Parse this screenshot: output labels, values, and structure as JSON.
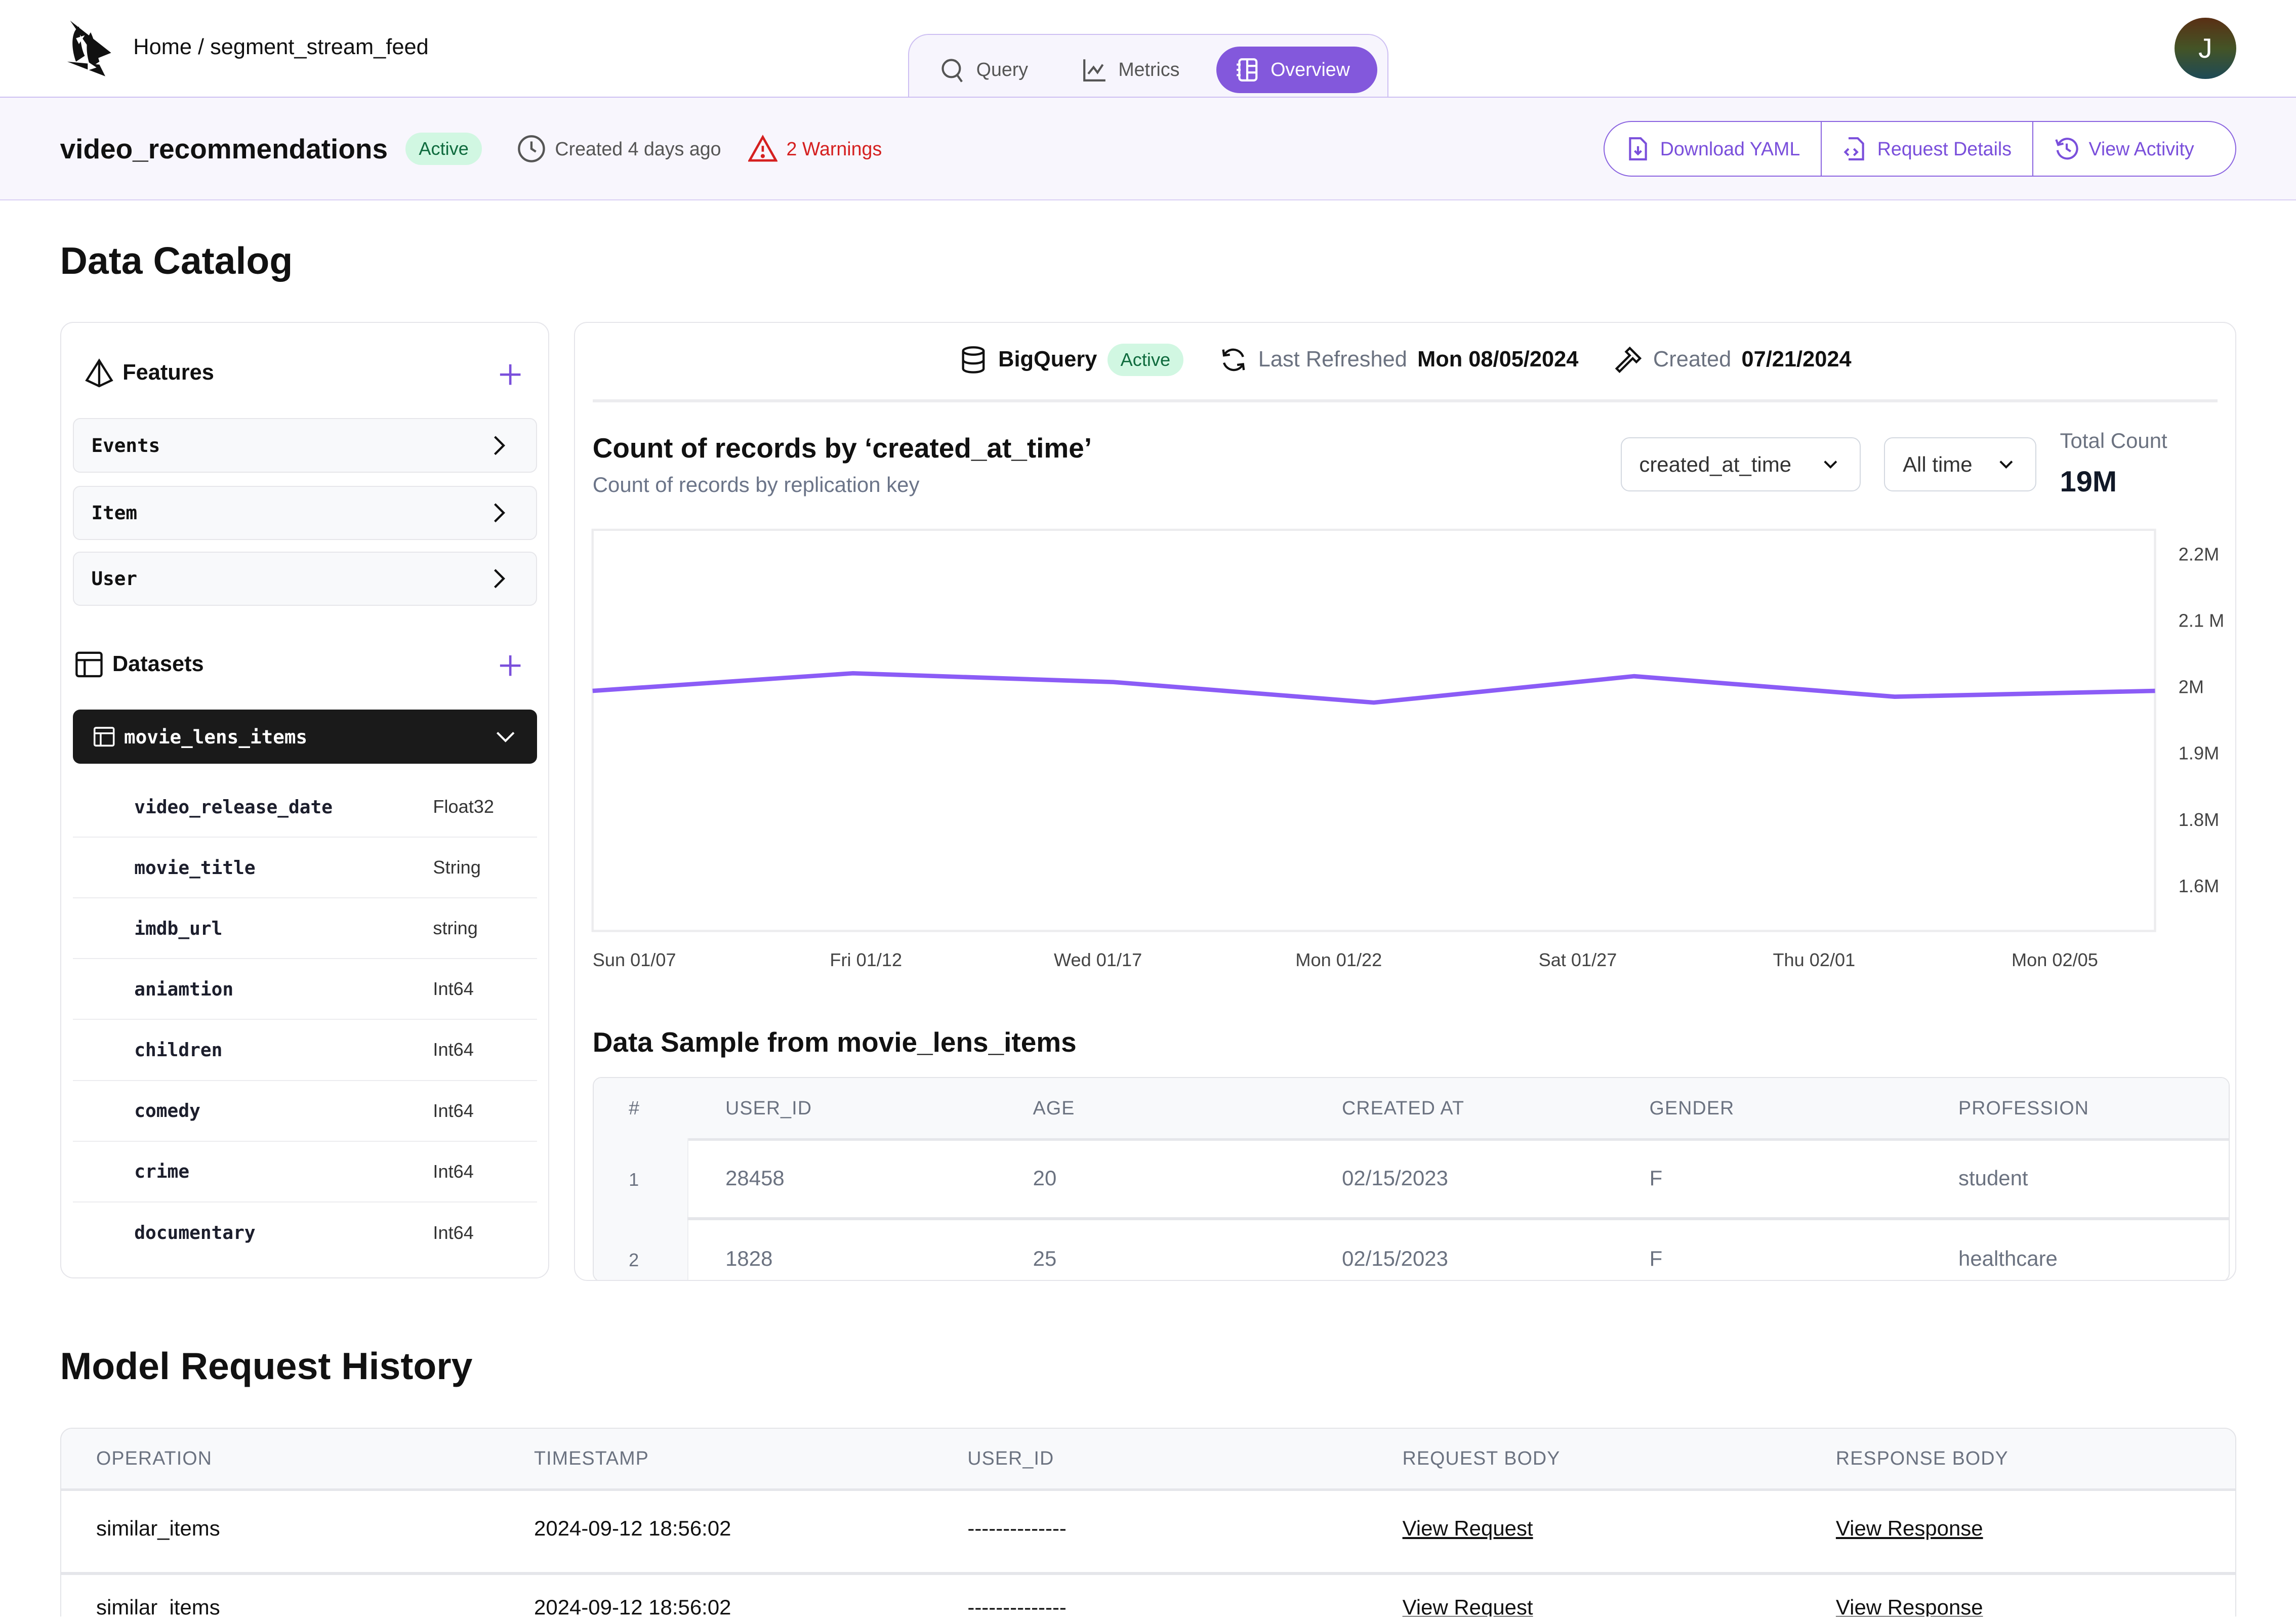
{
  "topbar": {
    "breadcrumb": "Home / segment_stream_feed",
    "tabs": [
      {
        "label": "Query",
        "icon": "search-icon",
        "active": false
      },
      {
        "label": "Metrics",
        "icon": "line-chart-icon",
        "active": false
      },
      {
        "label": "Overview",
        "icon": "notebook-icon",
        "active": true
      }
    ],
    "avatar_initial": "J"
  },
  "model": {
    "name": "video_recommendations",
    "status": "Active",
    "created": "Created 4 days ago",
    "warnings": "2 Warnings",
    "actions": [
      "Download YAML",
      "Request Details",
      "View Activity"
    ]
  },
  "catalog": {
    "title": "Data Catalog",
    "features_label": "Features",
    "features": [
      "Events",
      "Item",
      "User"
    ],
    "datasets_label": "Datasets",
    "selected_dataset": "movie_lens_items",
    "columns": [
      {
        "name": "video_release_date",
        "type": "Float32"
      },
      {
        "name": "movie_title",
        "type": "String"
      },
      {
        "name": "imdb_url",
        "type": "string"
      },
      {
        "name": "aniamtion",
        "type": "Int64"
      },
      {
        "name": "children",
        "type": "Int64"
      },
      {
        "name": "comedy",
        "type": "Int64"
      },
      {
        "name": "crime",
        "type": "Int64"
      },
      {
        "name": "documentary",
        "type": "Int64"
      }
    ]
  },
  "source": {
    "name": "BigQuery",
    "status": "Active",
    "last_refreshed_label": "Last Refreshed",
    "last_refreshed": "Mon 08/05/2024",
    "created_label": "Created",
    "created": "07/21/2024"
  },
  "chart_panel": {
    "title": "Count of records by ‘created_at_time’",
    "subtitle": "Count of records by replication key",
    "key_select": "created_at_time",
    "range_select": "All time",
    "total_label": "Total Count",
    "total_value": "19M"
  },
  "chart_data": {
    "type": "line",
    "title": "Count of records by ‘created_at_time’",
    "xlabel": "",
    "ylabel": "",
    "x": [
      "Sun 01/07",
      "Fri 01/12",
      "Wed 01/17",
      "Mon 01/22",
      "Sat 01/27",
      "Thu 02/01",
      "Mon 02/05"
    ],
    "series": [
      {
        "name": "Count of records",
        "color": "#8b5cf6",
        "values": [
          1960000,
          1990000,
          1975000,
          1940000,
          1985000,
          1950000,
          1960000
        ]
      }
    ],
    "y_ticks": [
      "2.2M",
      "2.1 M",
      "2M",
      "1.9M",
      "1.8M",
      "1.6M"
    ],
    "y_axis_side": "right",
    "ylim": [
      1550000,
      2235000
    ],
    "grid": false,
    "legend": "none"
  },
  "sample": {
    "title": "Data Sample from movie_lens_items",
    "headers": [
      "#",
      "USER_ID",
      "AGE",
      "CREATED AT",
      "GENDER",
      "PROFESSION"
    ],
    "rows": [
      [
        "1",
        "28458",
        "20",
        "02/15/2023",
        "F",
        "student"
      ],
      [
        "2",
        "1828",
        "25",
        "02/15/2023",
        "F",
        "healthcare"
      ]
    ]
  },
  "history": {
    "title": "Model Request History",
    "headers": [
      "OPERATION",
      "TIMESTAMP",
      "USER_ID",
      "REQUEST BODY",
      "RESPONSE BODY"
    ],
    "rows": [
      [
        "similar_items",
        "2024-09-12 18:56:02",
        "--------------",
        "View Request",
        "View Response"
      ],
      [
        "similar_items",
        "2024-09-12 18:56:02",
        "--------------",
        "View Request",
        "View Response"
      ]
    ]
  },
  "colors": {
    "accent": "#8358dc",
    "line": "#8b5cf6",
    "active_bg": "#d1f7e2",
    "active_fg": "#0f6b3e",
    "warning": "#d52020"
  }
}
